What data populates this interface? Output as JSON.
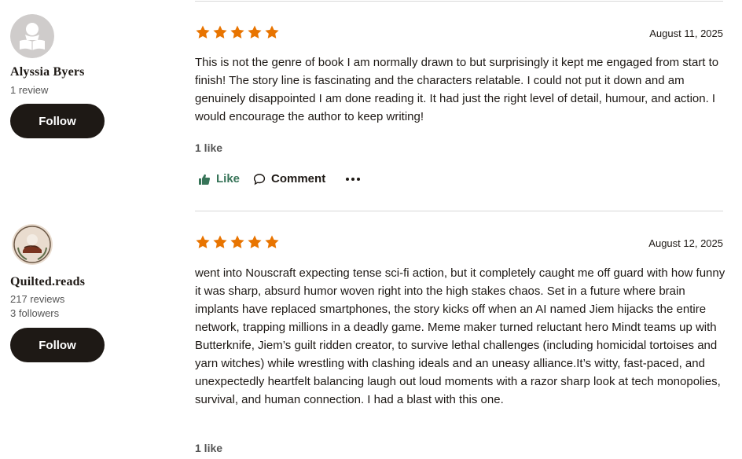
{
  "reviews": [
    {
      "reviewer": {
        "name": "Alyssia Byers",
        "stats": [
          "1 review"
        ],
        "follow_label": "Follow"
      },
      "rating": 5,
      "date": "August 11, 2025",
      "text": "This is not the genre of book I am normally drawn to but surprisingly it kept me engaged from start to finish! The story line is fascinating and the characters relatable. I could not put it down and am genuinely disappointed I am done reading it. It had just the right level of detail, humour, and action. I would encourage the author to keep writing!",
      "likes": "1 like",
      "actions": {
        "like": "Like",
        "comment": "Comment"
      }
    },
    {
      "reviewer": {
        "name": "Quilted.reads",
        "stats": [
          "217 reviews",
          "3 followers"
        ],
        "follow_label": "Follow"
      },
      "rating": 5,
      "date": "August 12, 2025",
      "text": "went into Nouscraft expecting tense sci-fi action, but it completely caught me off guard with how funny it was sharp, absurd humor woven right into the high stakes chaos. Set in a future where brain implants have replaced smartphones, the story kicks off when an AI named Jiem hijacks the entire network, trapping millions in a deadly game. Meme maker turned reluctant hero Mindt teams up with Butterknife, Jiem’s guilt ridden creator, to survive lethal challenges (including homicidal tortoises and yarn witches) while wrestling with clashing ideals and an uneasy alliance.It’s witty, fast-paced, and unexpectedly heartfelt balancing laugh out loud moments with a razor sharp look at tech monopolies, survival, and human connection. I had a blast with this one.",
      "likes": "1 like"
    }
  ],
  "colors": {
    "star": "#e87400",
    "button_bg": "#1e1915",
    "like_green": "#377458",
    "divider": "#d8d8d8"
  },
  "icons": {
    "star": "star-icon",
    "like": "thumbs-up-icon",
    "comment": "speech-bubble-icon",
    "more": "more-dots-icon"
  }
}
